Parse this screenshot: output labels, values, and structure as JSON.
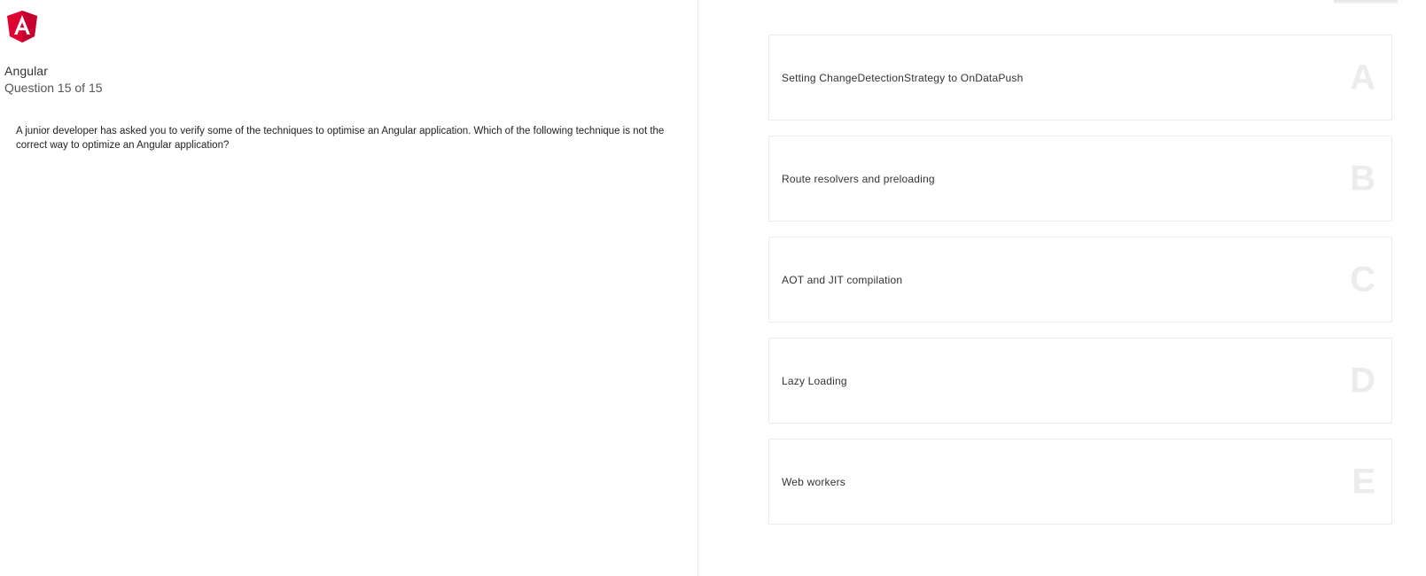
{
  "header": {
    "logo_icon": "angular-logo-icon",
    "brand_color": "#dd0031",
    "course_title": "Angular",
    "question_counter": "Question 15 of 15"
  },
  "question": {
    "text": "A junior developer has asked you to verify some of the techniques to optimise an Angular application. Which of the following technique is not the correct way to optimize an Angular application?"
  },
  "options": [
    {
      "letter": "A",
      "label": "Setting ChangeDetectionStrategy to OnDataPush"
    },
    {
      "letter": "B",
      "label": "Route resolvers and preloading"
    },
    {
      "letter": "C",
      "label": "AOT and JIT compilation"
    },
    {
      "letter": "D",
      "label": "Lazy Loading"
    },
    {
      "letter": "E",
      "label": "Web workers"
    }
  ]
}
